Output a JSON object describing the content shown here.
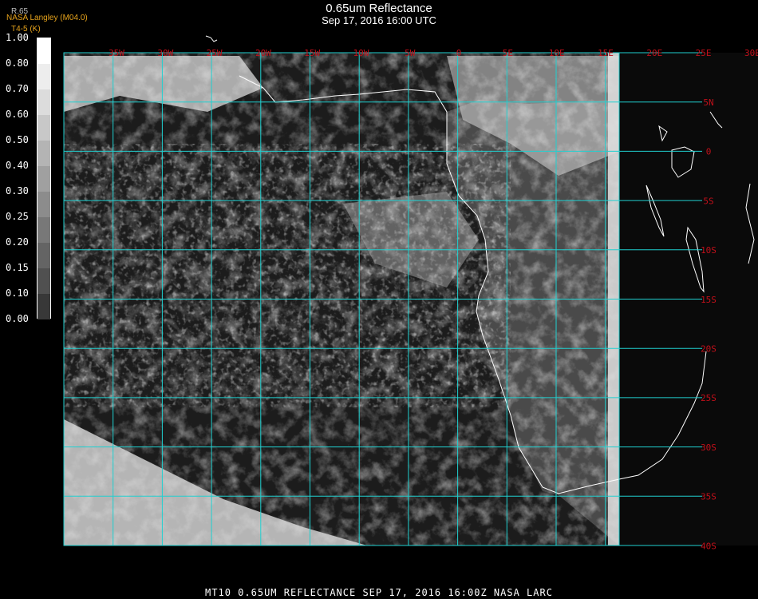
{
  "header": {
    "title": "0.65um Reflectance",
    "subtitle": "Sep 17, 2016 16:00 UTC",
    "credit": "NASA Langley (M04.0)",
    "temp_note": "T4-5 (K)",
    "fraction_note": "R.65"
  },
  "colorbar": {
    "labels": [
      "1.00",
      "0.80",
      "0.70",
      "0.60",
      "0.50",
      "0.40",
      "0.30",
      "0.25",
      "0.20",
      "0.15",
      "0.10",
      "0.00"
    ],
    "grays": [
      "#ffffff",
      "#ededed",
      "#dcdcdc",
      "#c8c8c8",
      "#b4b4b4",
      "#a0a0a0",
      "#8c8c8c",
      "#787878",
      "#646464",
      "#505050",
      "#383838",
      "#181818"
    ]
  },
  "map": {
    "grid_color": "#20d0d0",
    "label_color": "#c0101a",
    "longitude_labels": [
      "35W",
      "30W",
      "25W",
      "20W",
      "15W",
      "10W",
      "5W",
      "0",
      "5E",
      "10E",
      "15E",
      "20E",
      "25E",
      "30E",
      "35E"
    ],
    "latitude_labels": [
      "5N",
      "0",
      "5S",
      "10S",
      "15S",
      "20S",
      "25S",
      "30S",
      "35S",
      "40S"
    ],
    "extent": {
      "lon_min": -40,
      "lon_max": 35,
      "lat_min": -40,
      "lat_max": 10
    }
  },
  "footer": {
    "text": "MT10  0.65UM REFLECTANCE   SEP 17, 2016 16:00Z   NASA LARC"
  }
}
